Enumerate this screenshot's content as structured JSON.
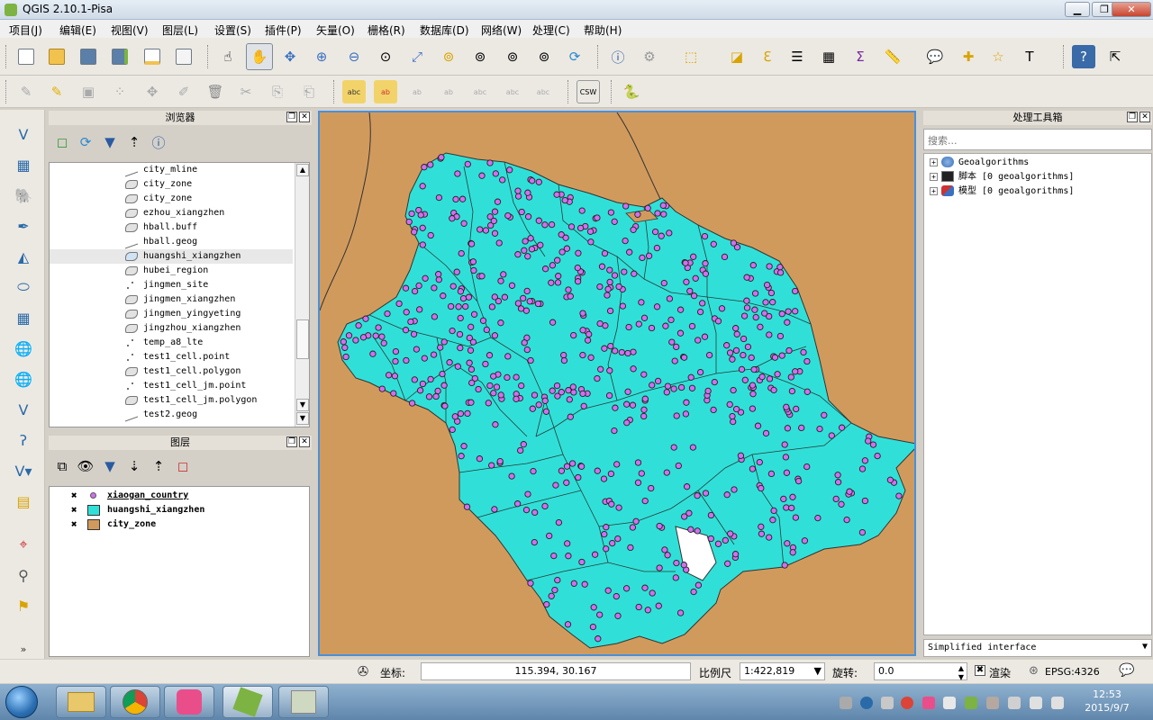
{
  "window": {
    "title": "QGIS 2.10.1-Pisa",
    "minimize": "▁",
    "maximize": "❐",
    "close": "✕"
  },
  "menu": [
    "项目(J)",
    "编辑(E)",
    "视图(V)",
    "图层(L)",
    "设置(S)",
    "插件(P)",
    "矢量(O)",
    "栅格(R)",
    "数据库(D)",
    "网络(W)",
    "处理(C)",
    "帮助(H)"
  ],
  "browser": {
    "title": "浏览器",
    "items": [
      {
        "label": "city_mline",
        "type": "line"
      },
      {
        "label": "city_zone",
        "type": "polygon"
      },
      {
        "label": "city_zone",
        "type": "polygon"
      },
      {
        "label": "ezhou_xiangzhen",
        "type": "polygon"
      },
      {
        "label": "hball.buff",
        "type": "polygon"
      },
      {
        "label": "hball.geog",
        "type": "line"
      },
      {
        "label": "huangshi_xiangzhen",
        "type": "polygon"
      },
      {
        "label": "hubei_region",
        "type": "polygon"
      },
      {
        "label": "jingmen_site",
        "type": "point"
      },
      {
        "label": "jingmen_xiangzhen",
        "type": "polygon"
      },
      {
        "label": "jingmen_yingyeting",
        "type": "polygon"
      },
      {
        "label": "jingzhou_xiangzhen",
        "type": "polygon"
      },
      {
        "label": "temp_a8_lte",
        "type": "point"
      },
      {
        "label": "test1_cell.point",
        "type": "point"
      },
      {
        "label": "test1_cell.polygon",
        "type": "polygon"
      },
      {
        "label": "test1_cell_jm.point",
        "type": "point"
      },
      {
        "label": "test1_cell_jm.polygon",
        "type": "polygon"
      },
      {
        "label": "test2.geog",
        "type": "line"
      }
    ],
    "selected_index": 6
  },
  "layers": {
    "title": "图层",
    "items": [
      {
        "label": "xiaogan_country",
        "symbol": "point",
        "color": "#d070f0",
        "checked": "✖"
      },
      {
        "label": "huangshi_xiangzhen",
        "symbol": "fill",
        "color": "#30e0d8",
        "checked": "✖"
      },
      {
        "label": "city_zone",
        "symbol": "fill",
        "color": "#d19a5d",
        "checked": "✖"
      }
    ]
  },
  "processing": {
    "title": "处理工具箱",
    "search_placeholder": "搜索...",
    "items": [
      "Geoalgorithms",
      "脚本 [0 geoalgorithms]",
      "模型 [0 geoalgorithms]"
    ],
    "mode": "Simplified interface"
  },
  "map": {
    "background_color": "#d19a5d",
    "region_color": "#30e0d8",
    "point_color": "#d070f0",
    "outline_color": "#333333"
  },
  "status": {
    "coord_label": "坐标:",
    "coord_value": "115.394, 30.167",
    "scale_label": "比例尺",
    "scale_value": "1:422,819",
    "rotation_label": "旋转:",
    "rotation_value": "0.0",
    "render_label": "渲染",
    "render_checked": "✖",
    "crs": "EPSG:4326"
  },
  "taskbar": {
    "time": "12:53",
    "date": "2015/9/7"
  }
}
